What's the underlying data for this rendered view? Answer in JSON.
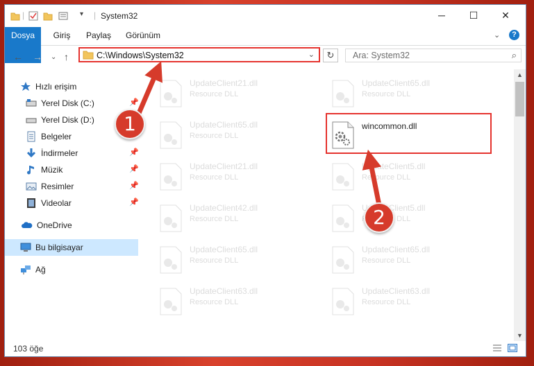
{
  "window": {
    "title": "System32",
    "controls": [
      "minimize",
      "maximize",
      "close"
    ]
  },
  "ribbon": {
    "tabs": [
      "Dosya",
      "Giriş",
      "Paylaş",
      "Görünüm"
    ]
  },
  "navbar": {
    "address": "C:\\Windows\\System32",
    "search_placeholder": "Ara: System32"
  },
  "sidebar": {
    "items": [
      {
        "label": "Hızlı erişim",
        "icon": "star-icon"
      },
      {
        "label": "Yerel Disk (C:)",
        "icon": "drive-icon",
        "pinned": true
      },
      {
        "label": "Yerel Disk (D:)",
        "icon": "drive-icon",
        "pinned": false
      },
      {
        "label": "Belgeler",
        "icon": "documents-icon",
        "pinned": false
      },
      {
        "label": "İndirmeler",
        "icon": "download-icon",
        "pinned": true
      },
      {
        "label": "Müzik",
        "icon": "music-icon",
        "pinned": true
      },
      {
        "label": "Resimler",
        "icon": "pictures-icon",
        "pinned": true
      },
      {
        "label": "Videolar",
        "icon": "videos-icon",
        "pinned": true
      },
      {
        "label": "OneDrive",
        "icon": "onedrive-icon"
      },
      {
        "label": "Bu bilgisayar",
        "icon": "computer-icon",
        "selected": true
      },
      {
        "label": "Ağ",
        "icon": "network-icon"
      }
    ]
  },
  "files": {
    "left": [
      {
        "name": "UpdateClient21.dll",
        "type": "Resource DLL"
      },
      {
        "name": "UpdateClient65.dll",
        "type": "Resource DLL"
      },
      {
        "name": "UpdateClient21.dll",
        "type": "Resource DLL"
      },
      {
        "name": "UpdateClient42.dll",
        "type": "Resource DLL"
      },
      {
        "name": "UpdateClient65.dll",
        "type": "Resource DLL"
      },
      {
        "name": "UpdateClient63.dll",
        "type": "Resource DLL"
      }
    ],
    "right": [
      {
        "name": "UpdateClient65.dll",
        "type": "Resource DLL"
      },
      {
        "name": "wincommon.dll",
        "type": ""
      },
      {
        "name": "UpdateClient5.dll",
        "type": "Resource DLL"
      },
      {
        "name": "UpdateClient5.dll",
        "type": "Resource DLL"
      },
      {
        "name": "UpdateClient65.dll",
        "type": "Resource DLL"
      },
      {
        "name": "UpdateClient63.dll",
        "type": "Resource DLL"
      }
    ]
  },
  "status": {
    "item_count": "103 öğe"
  },
  "annotations": {
    "markers": [
      "1",
      "2"
    ],
    "color": "#d63b2b"
  }
}
